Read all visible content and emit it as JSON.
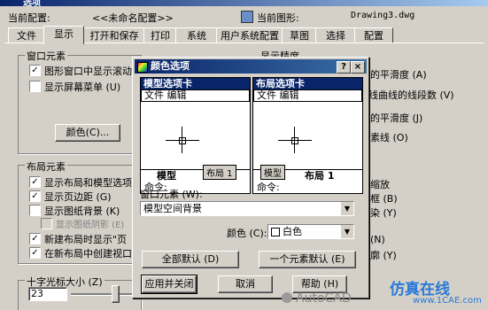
{
  "window": {
    "title": "选项"
  },
  "header": {
    "profile_label": "当前配置:",
    "profile_value": "<<未命名配置>>",
    "drawing_label": "当前图形:",
    "drawing_value": "Drawing3.dwg"
  },
  "tabs": [
    "文件",
    "显示",
    "打开和保存",
    "打印",
    "系统",
    "用户系统配置",
    "草图",
    "选择",
    "配置"
  ],
  "window_elements": {
    "group_label": "窗口元素",
    "scrollbar_option": "图形窗口中显示滚动",
    "screen_menu_option": "显示屏幕菜单 (U)",
    "colors_button": "颜色(C)..."
  },
  "display_resolution": {
    "group_label": "显示精度",
    "partial": [
      "的平滑度 (A)",
      "线曲线的线段数 (V)",
      "的平滑度 (J)",
      "素线 (O)"
    ]
  },
  "layout_elements": {
    "group_label": "布局元素",
    "items": [
      {
        "label": "显示布局和模型选项卡",
        "checked": true
      },
      {
        "label": "显示页边距 (G)",
        "checked": true
      },
      {
        "label": "显示图纸背景 (K)",
        "checked": false
      },
      {
        "label": "显示图纸阴影 (E)",
        "checked": false,
        "disabled": true
      },
      {
        "label": "新建布局时显示\"页",
        "checked": true
      },
      {
        "label": "在新布局中创建视口",
        "checked": true
      }
    ],
    "partial_right": [
      "缩放",
      "框 (B)",
      "染 (Y)",
      "(N)",
      "廓 (Y)"
    ]
  },
  "crosshair": {
    "label": "十字光标大小 (Z)",
    "value": "23"
  },
  "dialog": {
    "title": "颜色选项",
    "help_button": "?",
    "close_button": "×",
    "model_preview": {
      "header": "模型选项卡",
      "menu": "文件 编辑",
      "tab_model": "模型",
      "tab_layout": "布局 1",
      "command": "命令:"
    },
    "layout_preview": {
      "header": "布局选项卡",
      "menu": "文件 编辑",
      "tab_model": "模型",
      "tab_layout": "布局 1",
      "command": "命令:"
    },
    "element_label": "窗口元素 (W):",
    "element_value": "模型空间背景",
    "color_label": "颜色 (C):",
    "color_value": "白色",
    "default_all_button": "全部默认 (D)",
    "default_one_button": "一个元素默认 (E)",
    "apply_close_button": "应用并关闭",
    "cancel_button": "取消",
    "help_bottom_button": "帮助 (H)"
  },
  "watermark": {
    "left_text": "AutoCAD",
    "right_text": "仿真在线",
    "url": "www.1CAE.com"
  }
}
